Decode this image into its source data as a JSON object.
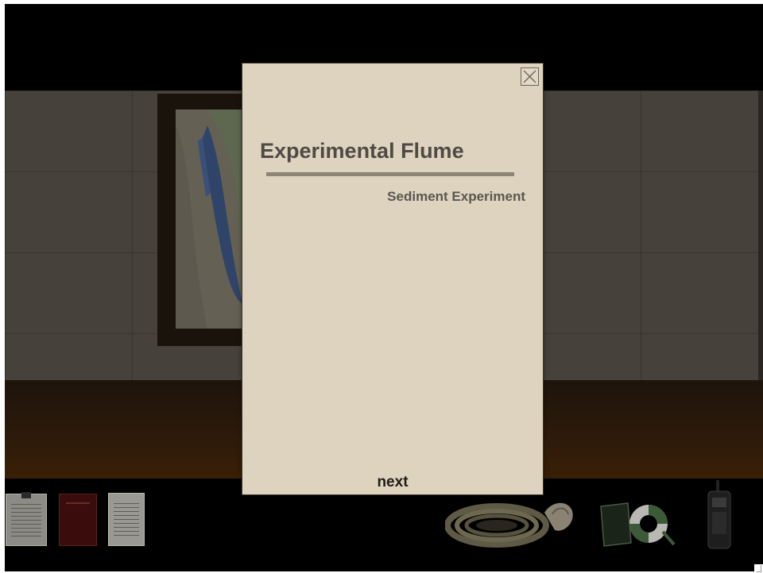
{
  "modal": {
    "title": "Experimental Flume",
    "subtitle": "Sediment Experiment",
    "next_label": "next",
    "close_icon": "close-icon"
  },
  "inventory": {
    "items": [
      {
        "name": "document-clipboard-icon"
      },
      {
        "name": "red-folder-icon"
      },
      {
        "name": "document-page-icon"
      },
      {
        "name": "coiled-rope-icon"
      },
      {
        "name": "sign-and-life-ring-icon"
      },
      {
        "name": "walkie-talkie-icon"
      }
    ]
  },
  "colors": {
    "modal_bg": "#ded3bf",
    "title": "#4f4a44",
    "rule": "#8e8576",
    "wall": "#46413a",
    "floor": "#3a1f06"
  }
}
